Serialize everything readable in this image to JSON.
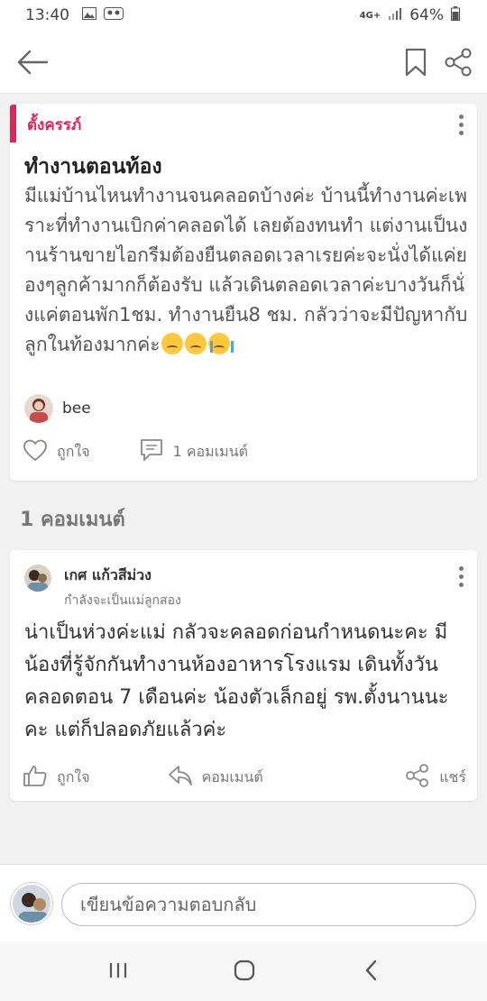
{
  "status_bar": {
    "time": "13:40",
    "network": "4G+",
    "battery": "64%"
  },
  "post": {
    "tag": "ตั้งครรภ์",
    "title": "ทำงานตอนท้อง",
    "body": "มีแม่บ้านไหนทำงานจนคลอดบ้างค่ะ บ้านนี้ทำงานค่ะเพราะที่ทำงานเบิกค่าคลอดได้ เลยต้องทนทำ แต่งานเป็นงานร้านขายไอกรีมต้องยืนตลอดเวลาเรยค่ะจะนั่งได้แค่ยองๆลูกค้ามากก็ต้องรับ แล้วเดินตลอดเวลาค่ะบางวันก็นั่งแค่ตอนพัก1ชม. ทำงานยืน8 ชม. กลัวว่าจะมีปัญหากับลูกในท้องมากค่ะ",
    "author": "bee",
    "like_label": "ถูกใจ",
    "comment_label": "1 คอมเมนต์"
  },
  "comments_heading": "1 คอมเมนต์",
  "comment": {
    "name": "เกศ แก้วสีม่วง",
    "subtitle": "กำลังจะเป็นแม่ลูกสอง",
    "body": "น่าเป็นห่วงค่ะแม่ กลัวจะคลอดก่อนกำหนดนะคะ มีน้องที่รู้จักกันทำงานห้องอาหารโรงแรม เดินทั้งวัน คลอดตอน 7 เดือนค่ะ น้องตัวเล็กอยู่ รพ.ตั้งนานนะคะ แต่ก็ปลอดภัยแล้วค่ะ",
    "like_label": "ถูกใจ",
    "comment_label": "คอมเมนต์",
    "share_label": "แชร์"
  },
  "reply": {
    "placeholder": "เขียนข้อความตอบกลับ"
  },
  "colors": {
    "accent": "#e0245e",
    "icon": "#777777"
  }
}
